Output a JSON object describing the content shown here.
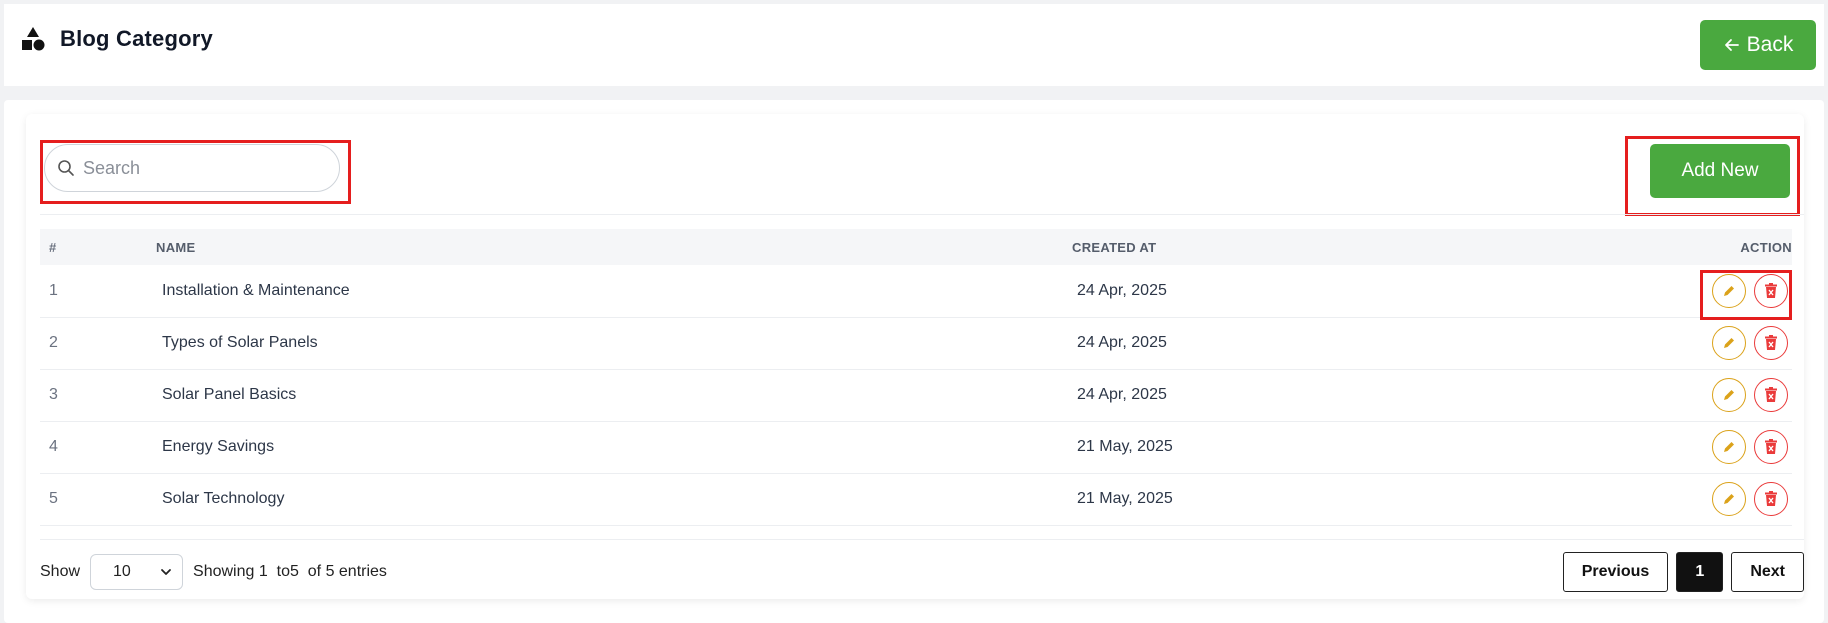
{
  "header": {
    "title": "Blog Category",
    "back_label": "Back"
  },
  "search": {
    "placeholder": "Search",
    "value": ""
  },
  "toolbar": {
    "add_label": "Add New"
  },
  "table": {
    "columns": [
      "#",
      "NAME",
      "CREATED AT",
      "ACTION"
    ],
    "rows": [
      {
        "num": "1",
        "name": "Installation & Maintenance",
        "created": "24 Apr, 2025"
      },
      {
        "num": "2",
        "name": "Types of Solar Panels",
        "created": "24 Apr, 2025"
      },
      {
        "num": "3",
        "name": "Solar Panel Basics",
        "created": "24 Apr, 2025"
      },
      {
        "num": "4",
        "name": "Energy Savings",
        "created": "21 May, 2025"
      },
      {
        "num": "5",
        "name": "Solar Technology",
        "created": "21 May, 2025"
      }
    ]
  },
  "footer": {
    "show_label": "Show",
    "per_page": "10",
    "showing_text": "Showing 1  to5  of 5 entries",
    "prev_label": "Previous",
    "page": "1",
    "next_label": "Next"
  },
  "colors": {
    "accent_green": "#4aa93f",
    "highlight_red": "#e51e1e",
    "edit_orange": "#dba21a",
    "delete_red": "#ea3b3b"
  },
  "icons": {
    "title": "shapes-icon",
    "back": "arrow-left-icon",
    "search": "search-icon",
    "edit": "pencil-icon",
    "delete": "trash-icon",
    "select": "chevron-down-icon"
  }
}
